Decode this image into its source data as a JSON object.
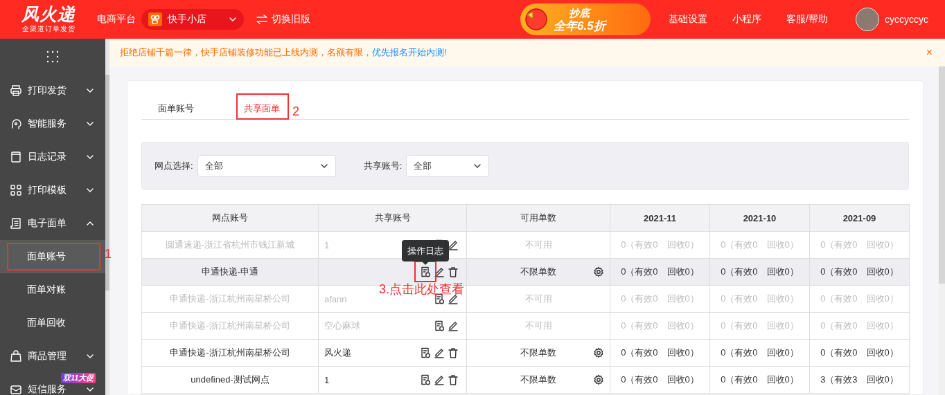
{
  "header": {
    "logo": "风火递",
    "tagline": "全渠道订单发货",
    "platform_label": "电商平台",
    "platform": {
      "value": "快手小店"
    },
    "switch_link": "切换旧版",
    "promo": [
      "抄底",
      "全年6.5折"
    ],
    "nav": [
      "基础设置",
      "小程序",
      "客服/帮助"
    ],
    "user": "cyccyccyc"
  },
  "sidebar": {
    "items": [
      {
        "label": "打印发货",
        "kind": "printer",
        "expanded": false
      },
      {
        "label": "智能服务",
        "kind": "headset",
        "expanded": false
      },
      {
        "label": "日志记录",
        "kind": "log",
        "expanded": false
      },
      {
        "label": "打印模板",
        "kind": "grid",
        "expanded": false
      },
      {
        "label": "电子面单",
        "kind": "receipt",
        "expanded": true,
        "children": [
          {
            "label": "面单账号",
            "selected": true,
            "annotation": "1"
          },
          {
            "label": "面单对账",
            "selected": false
          },
          {
            "label": "面单回收",
            "selected": false
          }
        ]
      },
      {
        "label": "商品管理",
        "kind": "bag",
        "expanded": false
      },
      {
        "label": "短信服务",
        "kind": "mail",
        "expanded": false
      }
    ],
    "badge": "双11大促"
  },
  "notice": {
    "text": "拒绝店铺千篇一律，快手店铺装修功能已上线内测，名额有限，",
    "link": "优先报名开始内测!",
    "close": "×"
  },
  "tabs": [
    {
      "label": "面单账号",
      "selected": false
    },
    {
      "label": "共享面单",
      "selected": true,
      "annotation": "2"
    }
  ],
  "filters": [
    {
      "label": "网点选择:",
      "value": "全部"
    },
    {
      "label": "共享账号:",
      "value": "全部"
    }
  ],
  "table": {
    "columns": [
      "网点账号",
      "共享账号",
      "可用单数",
      "2021-11",
      "2021-10",
      "2021-09"
    ],
    "rows": [
      {
        "site": "圆通速递-浙江省杭州市钱江新城",
        "account": "1",
        "deletable": false,
        "available": "不可用",
        "disabled": true,
        "hovered": false,
        "months": [
          "0（有效0　回收0）",
          "0（有效0　回收0）",
          "0（有效0　回收0）"
        ]
      },
      {
        "site": "申通快递-申通",
        "account": "",
        "deletable": true,
        "available": "不限单数",
        "disabled": false,
        "hovered": true,
        "tooltip": "操作日志",
        "annotation": "3.点击此处查看",
        "months": [
          "0（有效0　回收0）",
          "0（有效0　回收0）",
          "0（有效0　回收0）"
        ]
      },
      {
        "site": "申通快递-浙江杭州南星桥公司",
        "account": "afann",
        "deletable": false,
        "available": "不可用",
        "disabled": true,
        "hovered": false,
        "months": [
          "0（有效0　回收0）",
          "0（有效0　回收0）",
          "0（有效0　回收0）"
        ]
      },
      {
        "site": "申通快递-浙江杭州南星桥公司",
        "account": "空心麻球",
        "deletable": false,
        "available": "不可用",
        "disabled": true,
        "hovered": false,
        "months": [
          "0（有效0　回收0）",
          "0（有效0　回收0）",
          "0（有效0　回收0）"
        ]
      },
      {
        "site": "申通快递-浙江杭州南星桥公司",
        "account": "风火递",
        "deletable": true,
        "available": "不限单数",
        "disabled": false,
        "hovered": false,
        "months": [
          "0（有效0　回收0）",
          "0（有效0　回收0）",
          "0（有效0　回收0）"
        ]
      },
      {
        "site": "undefined-测试网点",
        "account": "1",
        "deletable": true,
        "available": "不限单数",
        "disabled": false,
        "hovered": false,
        "months": [
          "0（有效0　回收0）",
          "0（有效0　回收0）",
          "3（有效3　回收0）"
        ]
      }
    ]
  }
}
